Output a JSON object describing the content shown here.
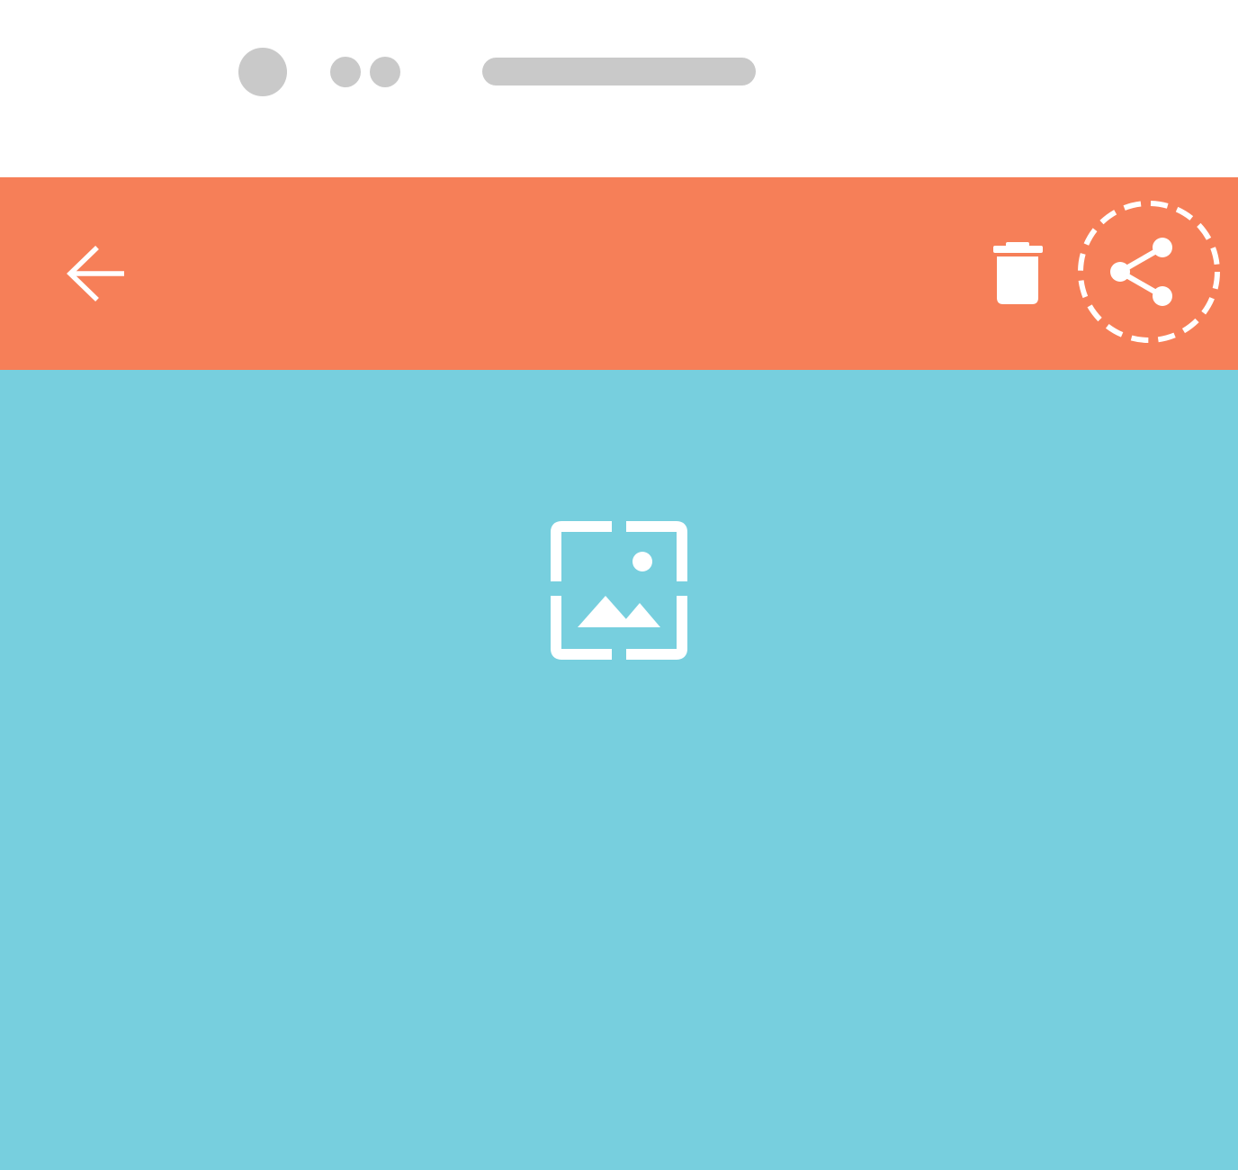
{
  "status_bar": {
    "color": "#c9c9c9"
  },
  "app_bar": {
    "background": "#f67f58",
    "back_icon": "arrow-left-icon",
    "actions": [
      {
        "icon": "trash-icon"
      },
      {
        "icon": "share-icon",
        "highlighted": true
      }
    ]
  },
  "content": {
    "background": "#77cfde",
    "placeholder_icon": "image-placeholder-icon"
  }
}
